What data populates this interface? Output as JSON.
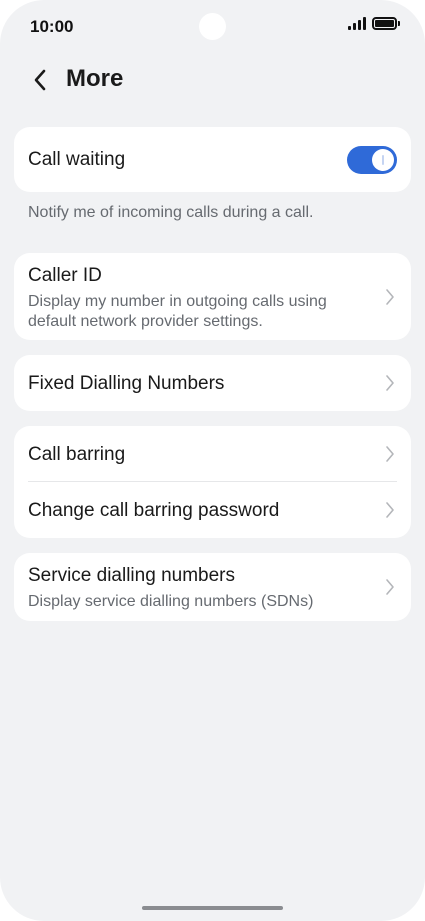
{
  "status_bar": {
    "time": "10:00"
  },
  "header": {
    "title": "More"
  },
  "call_waiting": {
    "title": "Call waiting",
    "enabled": true,
    "description": "Notify me of incoming calls during a call."
  },
  "caller_id": {
    "title": "Caller ID",
    "subtitle": "Display my number in outgoing calls using default network provider settings."
  },
  "fixed_dialling": {
    "title": "Fixed Dialling Numbers"
  },
  "call_barring": {
    "title": "Call barring",
    "change_password": "Change call barring password"
  },
  "service_dialling": {
    "title": "Service dialling numbers",
    "subtitle": "Display service dialling numbers (SDNs)"
  },
  "colors": {
    "accent": "#2f6ad8",
    "background": "#f1f2f4",
    "card": "#ffffff"
  }
}
